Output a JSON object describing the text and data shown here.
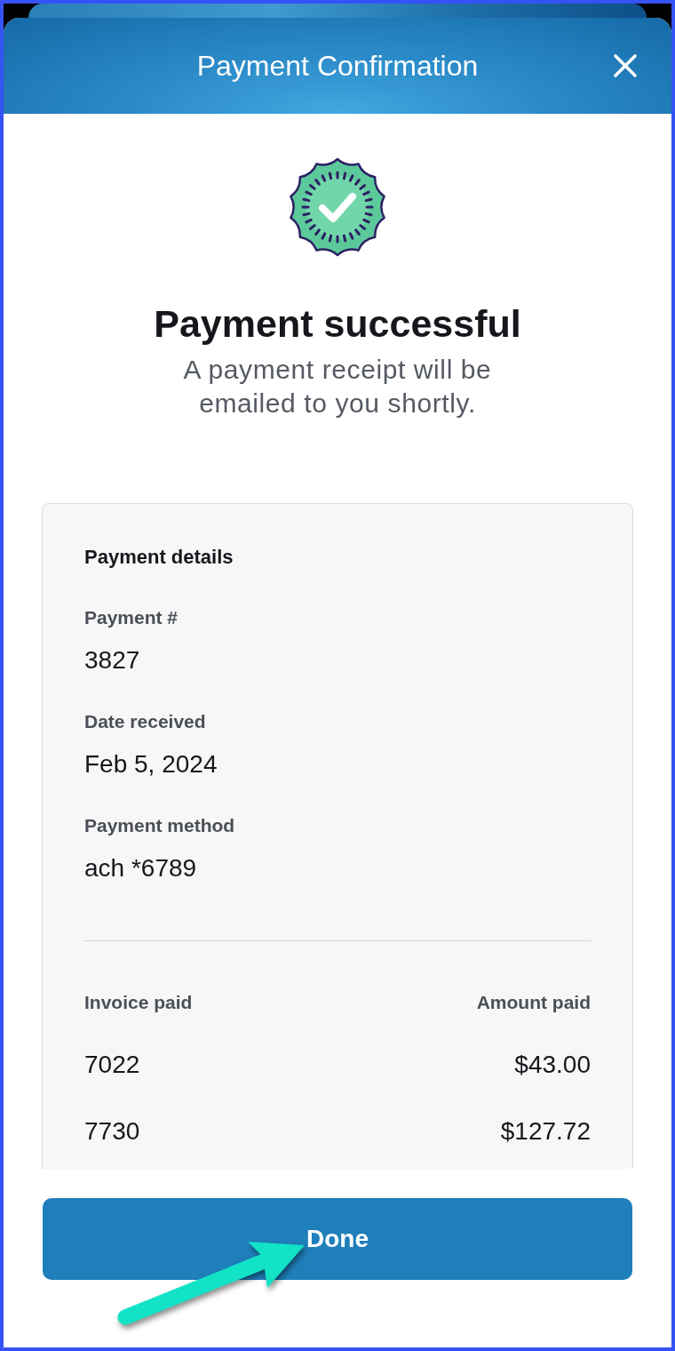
{
  "header": {
    "title": "Payment Confirmation"
  },
  "status": {
    "title": "Payment successful",
    "message": "A payment receipt will be emailed to you shortly."
  },
  "details": {
    "title": "Payment details",
    "fields": [
      {
        "label": "Payment #",
        "value": "3827"
      },
      {
        "label": "Date received",
        "value": "Feb 5, 2024"
      },
      {
        "label": "Payment method",
        "value": "ach *6789"
      }
    ],
    "table": {
      "columns": [
        "Invoice paid",
        "Amount paid"
      ],
      "rows": [
        [
          "7022",
          "$43.00"
        ],
        [
          "7730",
          "$127.72"
        ]
      ]
    }
  },
  "done_button": {
    "label": "Done"
  }
}
